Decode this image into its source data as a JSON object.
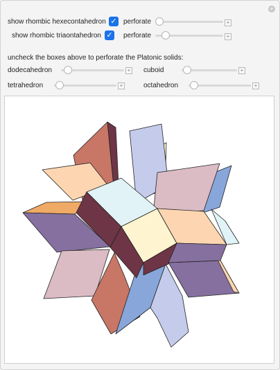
{
  "controls": {
    "hexecontahedron_label": "show rhombic hexecontahedron",
    "hexecontahedron_checked": true,
    "triacontahedron_label": "show rhombic triaontahedron",
    "triacontahedron_checked": true,
    "perforate_label": "perforate",
    "perforate_hex_value": 0,
    "perforate_tri_value": 0.05,
    "instructions": "uncheck the boxes above to perforate the Platonic solids:",
    "dodecahedron_label": "dodecahedron",
    "dodecahedron_value": 0.04,
    "cuboid_label": "cuboid",
    "cuboid_value": 0.04,
    "tetrahedron_label": "tetrahedron",
    "tetrahedron_value": 0.04,
    "octahedron_label": "octahedron",
    "octahedron_value": 0.04
  },
  "icons": {
    "checkmark": "✓",
    "plus": "+"
  },
  "colors": {
    "accent": "#1a73e8",
    "face_lavender": "#c5cbeb",
    "face_pink": "#dbbcc4",
    "face_peach": "#fdd6b1",
    "face_rust": "#c87666",
    "face_purple": "#86709f",
    "face_maroon": "#6e3546",
    "face_cream": "#fef4cf",
    "face_cyan": "#e1f3f6",
    "face_blue": "#88a6da",
    "face_orange": "#efaa66"
  }
}
